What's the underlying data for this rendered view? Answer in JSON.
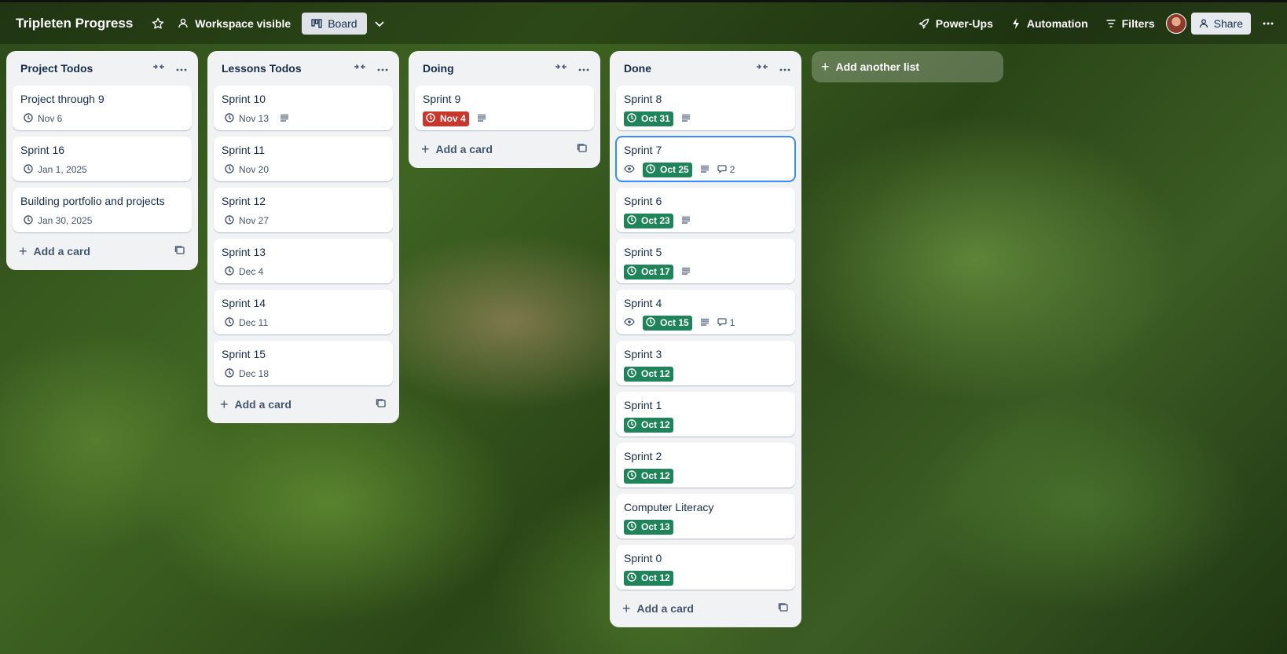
{
  "header": {
    "board_title": "Tripleten Progress",
    "visibility_label": "Workspace visible",
    "view_label": "Board",
    "powerups_label": "Power-Ups",
    "automation_label": "Automation",
    "filters_label": "Filters",
    "share_label": "Share"
  },
  "lists": [
    {
      "title": "Project Todos",
      "add_card_label": "Add a card",
      "cards": [
        {
          "title": "Project through 9",
          "due": "Nov 6",
          "due_status": "normal"
        },
        {
          "title": "Sprint 16",
          "due": "Jan 1, 2025",
          "due_status": "normal"
        },
        {
          "title": "Building portfolio and projects",
          "due": "Jan 30, 2025",
          "due_status": "normal"
        }
      ]
    },
    {
      "title": "Lessons Todos",
      "add_card_label": "Add a card",
      "cards": [
        {
          "title": "Sprint 10",
          "due": "Nov 13",
          "due_status": "normal",
          "description": true
        },
        {
          "title": "Sprint 11",
          "due": "Nov 20",
          "due_status": "normal"
        },
        {
          "title": "Sprint 12",
          "due": "Nov 27",
          "due_status": "normal"
        },
        {
          "title": "Sprint 13",
          "due": "Dec 4",
          "due_status": "normal"
        },
        {
          "title": "Sprint 14",
          "due": "Dec 11",
          "due_status": "normal"
        },
        {
          "title": "Sprint 15",
          "due": "Dec 18",
          "due_status": "normal"
        }
      ]
    },
    {
      "title": "Doing",
      "add_card_label": "Add a card",
      "cards": [
        {
          "title": "Sprint 9",
          "due": "Nov 4",
          "due_status": "overdue",
          "description": true
        }
      ]
    },
    {
      "title": "Done",
      "add_card_label": "Add a card",
      "cards": [
        {
          "title": "Sprint 8",
          "due": "Oct 31",
          "due_status": "complete",
          "description": true
        },
        {
          "title": "Sprint 7",
          "due": "Oct 25",
          "due_status": "complete",
          "watching": true,
          "description": true,
          "comments": "2",
          "selected": true
        },
        {
          "title": "Sprint 6",
          "due": "Oct 23",
          "due_status": "complete",
          "description": true
        },
        {
          "title": "Sprint 5",
          "due": "Oct 17",
          "due_status": "complete",
          "description": true
        },
        {
          "title": "Sprint 4",
          "due": "Oct 15",
          "due_status": "complete",
          "watching": true,
          "description": true,
          "comments": "1"
        },
        {
          "title": "Sprint 3",
          "due": "Oct 12",
          "due_status": "complete"
        },
        {
          "title": "Sprint 1",
          "due": "Oct 12",
          "due_status": "complete"
        },
        {
          "title": "Sprint 2",
          "due": "Oct 12",
          "due_status": "complete"
        },
        {
          "title": "Computer Literacy",
          "due": "Oct 13",
          "due_status": "complete"
        },
        {
          "title": "Sprint 0",
          "due": "Oct 12",
          "due_status": "complete"
        }
      ]
    }
  ],
  "add_list_label": "Add another list",
  "colors": {
    "complete": "#1f845a",
    "overdue": "#c9372c",
    "selected_outline": "#388bff"
  }
}
